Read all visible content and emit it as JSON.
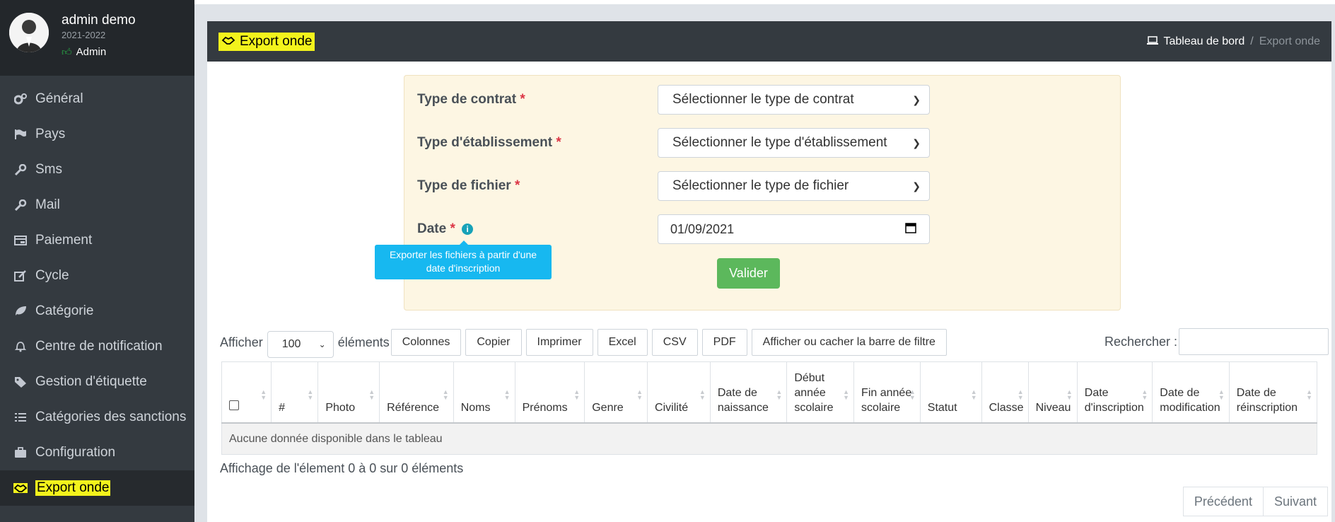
{
  "user": {
    "name": "admin demo",
    "year": "2021-2022",
    "role": "Admin"
  },
  "sidebar": {
    "items": [
      {
        "label": "Général",
        "icon": "cogs-icon"
      },
      {
        "label": "Pays",
        "icon": "flag-icon"
      },
      {
        "label": "Sms",
        "icon": "wrench-icon"
      },
      {
        "label": "Mail",
        "icon": "wrench-icon"
      },
      {
        "label": "Paiement",
        "icon": "money-icon"
      },
      {
        "label": "Cycle",
        "icon": "edit-icon"
      },
      {
        "label": "Catégorie",
        "icon": "leaf-icon"
      },
      {
        "label": "Centre de notification",
        "icon": "bell-icon"
      },
      {
        "label": "Gestion d'étiquette",
        "icon": "tag-icon"
      },
      {
        "label": "Catégories des sanctions",
        "icon": "list-icon"
      },
      {
        "label": "Configuration",
        "icon": "briefcase-icon"
      },
      {
        "label": "Export onde",
        "icon": "handshake-icon",
        "active": true
      }
    ]
  },
  "header": {
    "title": "Export onde",
    "breadcrumb": {
      "home": "Tableau de bord",
      "separator": "/",
      "current": "Export onde"
    }
  },
  "form": {
    "contract_label": "Type de contrat",
    "contract_placeholder": "Sélectionner le type de contrat",
    "establishment_label": "Type d'établissement",
    "establishment_placeholder": "Sélectionner le type d'établissement",
    "file_label": "Type de fichier",
    "file_placeholder": "Sélectionner le type de fichier",
    "date_label": "Date",
    "date_value": "01/09/2021",
    "required_mark": "*",
    "tooltip": "Exporter les fichiers à partir d'une date d'inscription",
    "submit_label": "Valider"
  },
  "table_controls": {
    "show_label": "Afficher",
    "page_length": "100",
    "elements_label": "éléments",
    "buttons": [
      "Colonnes",
      "Copier",
      "Imprimer",
      "Excel",
      "CSV",
      "PDF",
      "Afficher ou cacher la barre de filtre"
    ],
    "search_label": "Rechercher :"
  },
  "table": {
    "columns": [
      "#",
      "Photo",
      "Référence",
      "Noms",
      "Prénoms",
      "Genre",
      "Civilité",
      "Date de naissance",
      "Début année scolaire",
      "Fin année scolaire",
      "Statut",
      "Classe",
      "Niveau",
      "Date d'inscription",
      "Date de modification",
      "Date de réinscription"
    ],
    "empty_message": "Aucune donnée disponible dans le tableau"
  },
  "footer": {
    "info": "Affichage de l'élement 0 à 0 sur 0 éléments",
    "previous": "Précédent",
    "next": "Suivant"
  },
  "colors": {
    "sidebar": "#343a40",
    "highlight": "#f3f31c",
    "success": "#5cb85c",
    "info": "#17b8f0",
    "form_bg": "#fdf6e3"
  }
}
